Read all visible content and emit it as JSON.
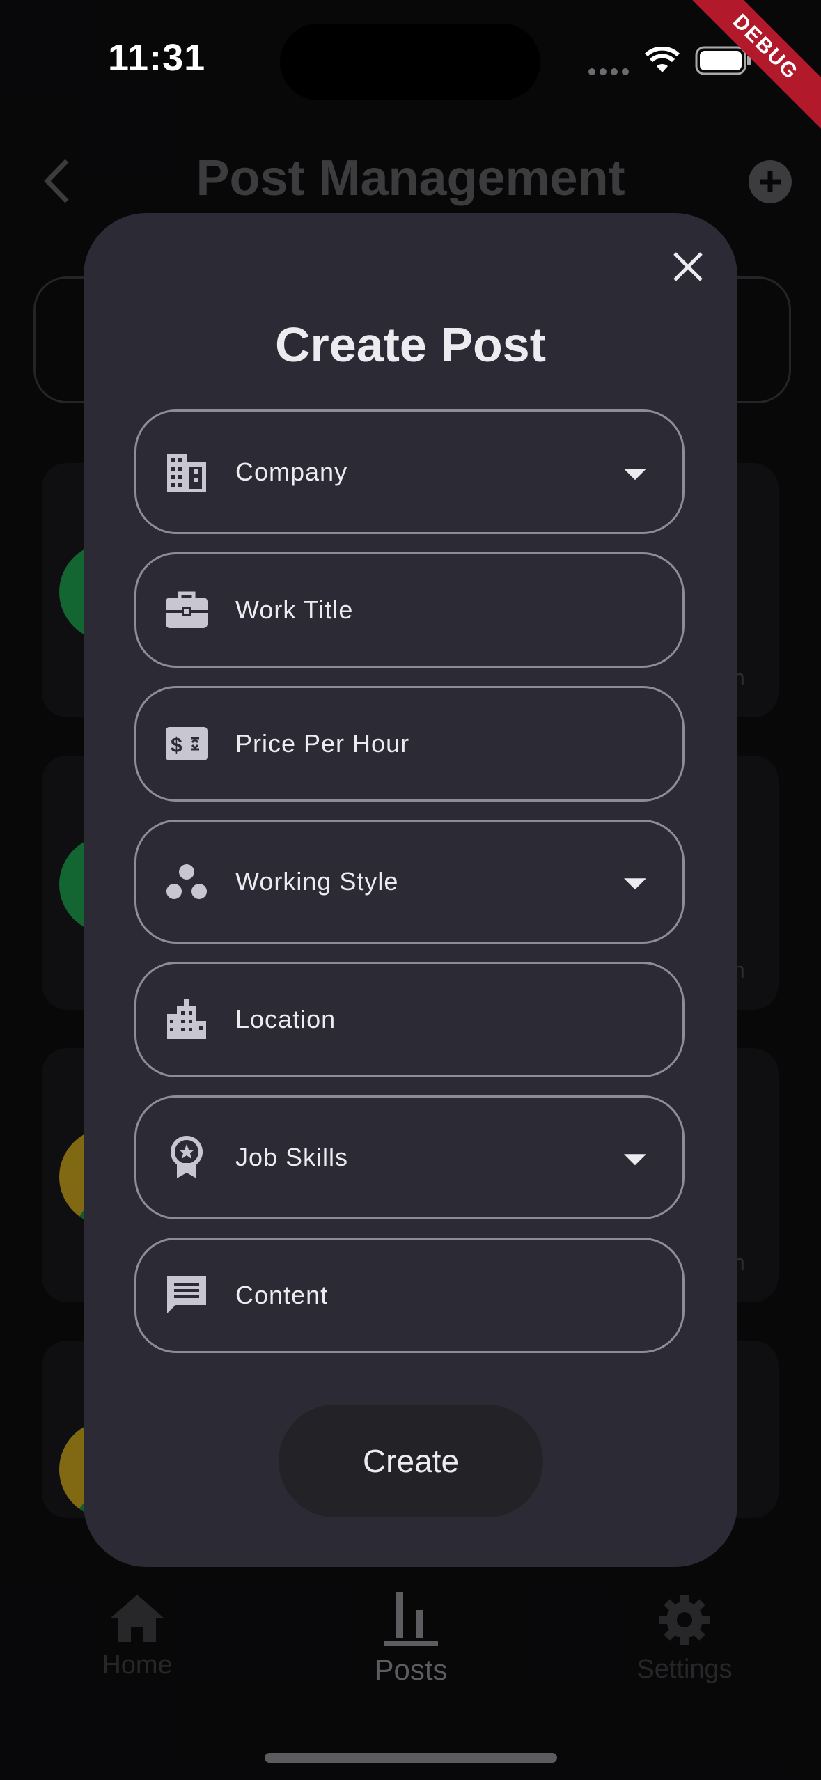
{
  "status_bar": {
    "time": "11:31",
    "debug_label": "DEBUG"
  },
  "background": {
    "title": "Post Management",
    "card_suffix_text": "h",
    "nav": [
      {
        "label": "Home",
        "icon": "home-icon",
        "active": false
      },
      {
        "label": "Posts",
        "icon": "bar-chart-icon",
        "active": true
      },
      {
        "label": "Settings",
        "icon": "gear-icon",
        "active": false
      }
    ]
  },
  "dialog": {
    "title": "Create Post",
    "close_icon": "close-icon",
    "fields": [
      {
        "label": "Company",
        "icon": "building-icon",
        "dropdown": true
      },
      {
        "label": "Work Title",
        "icon": "briefcase-icon",
        "dropdown": false
      },
      {
        "label": "Price Per Hour",
        "icon": "price-icon",
        "dropdown": false
      },
      {
        "label": "Working Style",
        "icon": "workspaces-icon",
        "dropdown": true
      },
      {
        "label": "Location",
        "icon": "city-icon",
        "dropdown": false
      },
      {
        "label": "Job Skills",
        "icon": "badge-icon",
        "dropdown": true
      },
      {
        "label": "Content",
        "icon": "message-icon",
        "dropdown": false
      }
    ],
    "submit_label": "Create"
  },
  "colors": {
    "background": "#0d0d0f",
    "dialog": "#2c2a35",
    "field_border": "#8e8c96",
    "text": "#ecebf0",
    "button": "#232227",
    "debug": "#b2192b"
  }
}
